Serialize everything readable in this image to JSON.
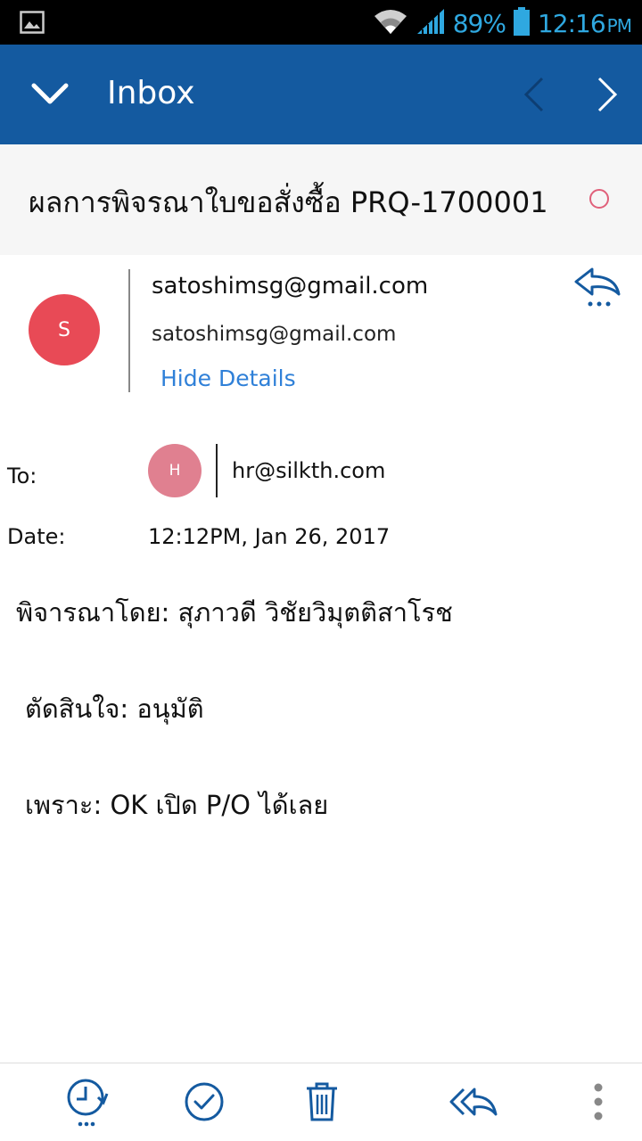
{
  "status_bar": {
    "battery": "89%",
    "time": "12:16",
    "ampm": "PM"
  },
  "app_bar": {
    "title": "Inbox"
  },
  "email": {
    "subject": "ผลการพิจรณาใบขอสั่งซื้อ PRQ-1700001",
    "sender": {
      "avatar_letter": "S",
      "name": "satoshimsg@gmail.com",
      "email": "satoshimsg@gmail.com",
      "hide_details_label": "Hide Details"
    },
    "to": {
      "label": "To:",
      "avatar_letter": "H",
      "address": "hr@silkth.com"
    },
    "date": {
      "label": "Date:",
      "value": "12:12PM, Jan 26, 2017"
    },
    "body": [
      "พิจารณาโดย: สุภาวดี วิชัยวิมุตติสาโรช",
      "ตัดสินใจ: อนุมัติ",
      "เพราะ: OK เปิด P/O ได้เลย"
    ]
  },
  "icons": {
    "status_left": "image-icon",
    "wifi": "wifi-icon",
    "signal": "signal-icon",
    "battery": "battery-icon",
    "back": "chevron-down-icon",
    "prev": "chevron-left-icon",
    "next": "chevron-right-icon",
    "flag": "circle-flag-icon",
    "reply": "reply-icon",
    "schedule": "clock-icon",
    "done": "check-circle-icon",
    "delete": "trash-icon",
    "reply_all": "reply-all-icon",
    "more": "more-vertical-icon"
  },
  "colors": {
    "app_bar": "#145aa0",
    "accent_blue": "#2f80d8",
    "sender_avatar": "#e84a56",
    "to_avatar": "#e08090",
    "status_text": "#2fa8e0"
  }
}
